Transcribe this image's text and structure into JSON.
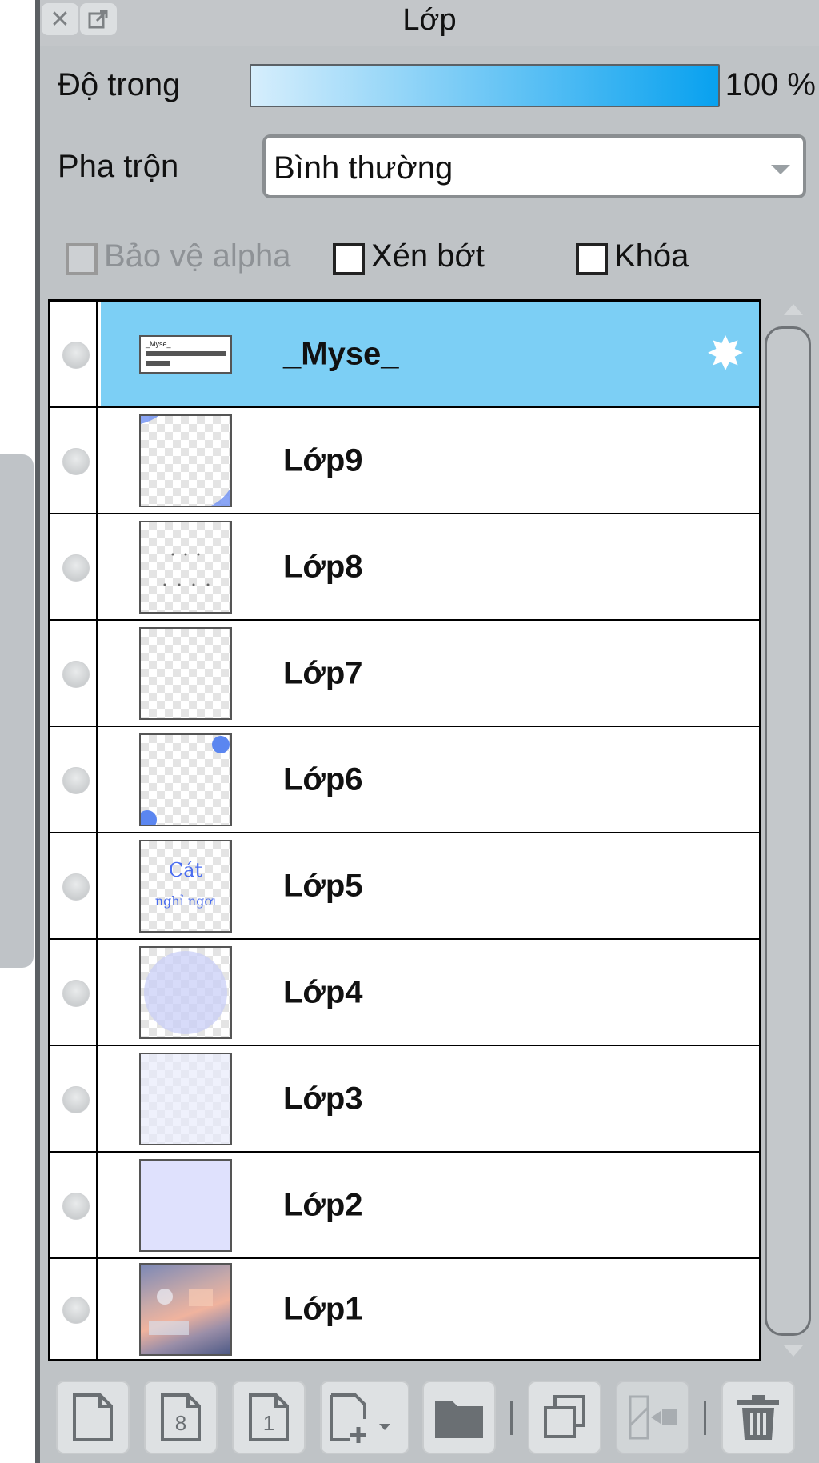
{
  "window": {
    "title": "Lớp",
    "close_icon": "close-icon",
    "popout_icon": "popout-icon"
  },
  "opacity": {
    "label": "Độ trong",
    "value": "100 %",
    "fill_percent": 100
  },
  "blend": {
    "label": "Pha trộn",
    "selected": "Bình thường"
  },
  "checkboxes": [
    {
      "label": "Bảo vệ alpha",
      "checked": false,
      "disabled": true
    },
    {
      "label": "Xén bớt",
      "checked": false,
      "disabled": false
    },
    {
      "label": "Khóa",
      "checked": false,
      "disabled": false
    }
  ],
  "layers": [
    {
      "name": "_Myse_",
      "selected": true,
      "thumb": "text",
      "gear": true
    },
    {
      "name": "Lớp9",
      "selected": false,
      "thumb": "transparent-corners"
    },
    {
      "name": "Lớp8",
      "selected": false,
      "thumb": "transparent-dots"
    },
    {
      "name": "Lớp7",
      "selected": false,
      "thumb": "transparent"
    },
    {
      "name": "Lớp6",
      "selected": false,
      "thumb": "transparent-blobs"
    },
    {
      "name": "Lớp5",
      "selected": false,
      "thumb": "text-art"
    },
    {
      "name": "Lớp4",
      "selected": false,
      "thumb": "soft-circle"
    },
    {
      "name": "Lớp3",
      "selected": false,
      "thumb": "light-tint"
    },
    {
      "name": "Lớp2",
      "selected": false,
      "thumb": "solid"
    },
    {
      "name": "Lớp1",
      "selected": false,
      "thumb": "photo"
    }
  ],
  "thumb_text": {
    "myse_thumb": "_Myse_",
    "layer5_thumb_line1": "Cát",
    "layer5_thumb_line2": "nghỉ ngơi"
  },
  "toolbar": {
    "buttons": [
      {
        "name": "new-layer-button",
        "icon": "page-icon"
      },
      {
        "name": "new-8bit-layer-button",
        "icon": "page-8-icon",
        "glyph": "8"
      },
      {
        "name": "new-1bit-layer-button",
        "icon": "page-1-icon",
        "glyph": "1"
      },
      {
        "name": "add-layer-menu-button",
        "icon": "page-plus-dropdown-icon"
      },
      {
        "name": "new-folder-button",
        "icon": "folder-icon"
      },
      {
        "name": "duplicate-layer-button",
        "icon": "duplicate-icon"
      },
      {
        "name": "merge-down-button",
        "icon": "merge-icon",
        "disabled": true
      },
      {
        "name": "delete-layer-button",
        "icon": "trash-icon"
      }
    ]
  },
  "colors": {
    "selected_row": "#7ccff5",
    "slider_start": "#d6eefc",
    "slider_end": "#08a1ef",
    "panel_bg": "#bfc3c6"
  }
}
